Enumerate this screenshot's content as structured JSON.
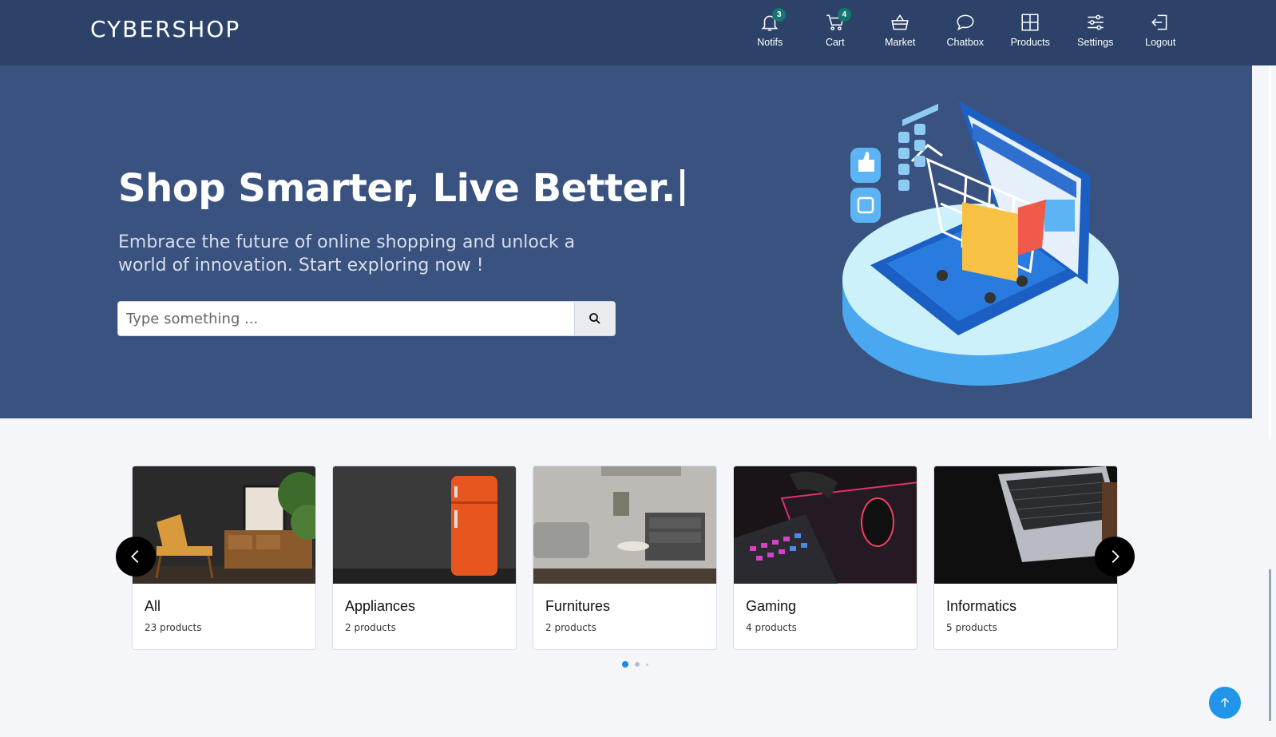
{
  "header": {
    "brand": "CYBERSHOP",
    "nav": [
      {
        "label": "Notifs",
        "icon": "bell-icon",
        "badge": "3"
      },
      {
        "label": "Cart",
        "icon": "cart-icon",
        "badge": "4"
      },
      {
        "label": "Market",
        "icon": "basket-icon"
      },
      {
        "label": "Chatbox",
        "icon": "chat-bubble-icon"
      },
      {
        "label": "Products",
        "icon": "grid-icon"
      },
      {
        "label": "Settings",
        "icon": "sliders-icon"
      },
      {
        "label": "Logout",
        "icon": "logout-icon"
      }
    ]
  },
  "hero": {
    "headline": "Shop Smarter, Live Better.",
    "subtext": "Embrace the future of online shopping and unlock a world of innovation. Start exploring now !",
    "search_placeholder": "Type something ...",
    "search_icon": "search-icon"
  },
  "categories": [
    {
      "title": "All",
      "count": "23 products",
      "image": "living-room-chair-photo"
    },
    {
      "title": "Appliances",
      "count": "2 products",
      "image": "orange-fridge-photo"
    },
    {
      "title": "Furnitures",
      "count": "2 products",
      "image": "sofa-room-photo"
    },
    {
      "title": "Gaming",
      "count": "4 products",
      "image": "gaming-keyboard-mouse-photo"
    },
    {
      "title": "Informatics",
      "count": "5 products",
      "image": "laptop-photo"
    }
  ],
  "carousel": {
    "active_page": 1,
    "pages": 3
  },
  "colors": {
    "header": "#2d4268",
    "hero": "#39527f",
    "badge": "#14766f",
    "accent": "#1e88e5"
  }
}
